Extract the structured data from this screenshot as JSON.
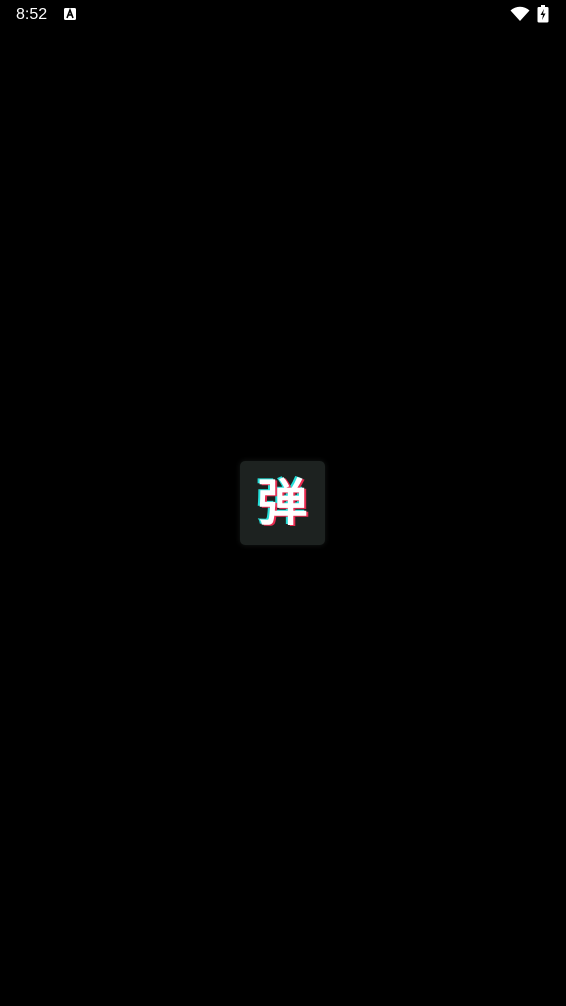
{
  "status_bar": {
    "time": "8:52",
    "notification_icon": "accessibility-a-icon",
    "wifi_icon": "wifi-icon",
    "battery_icon": "battery-charging-icon"
  },
  "splash": {
    "logo_glyph": "弹",
    "logo_icon": "app-logo-icon",
    "colors": {
      "background": "#000000",
      "logo_bg": "#1d2220",
      "glitch_cyan": "#25f4ee",
      "glitch_red": "#fe2c55"
    }
  }
}
